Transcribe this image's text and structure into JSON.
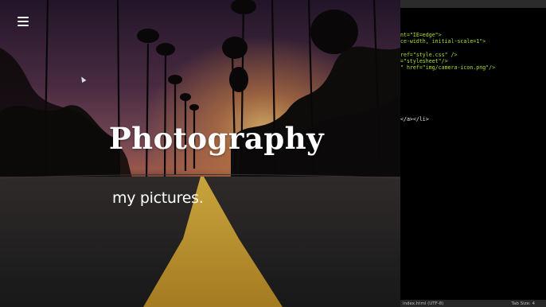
{
  "site": {
    "menu_icon": "hamburger-menu-icon",
    "title": "Photography",
    "subtitle": "my pictures."
  },
  "editor": {
    "code_lines": [
      {
        "parts": [
          {
            "t": "nt=\"IE=edge\">",
            "c": "g"
          }
        ]
      },
      {
        "parts": [
          {
            "t": "ce-width, initial-scale=1\">",
            "c": "g"
          }
        ]
      },
      {
        "parts": [
          {
            "t": "",
            "c": "w"
          }
        ]
      },
      {
        "parts": [
          {
            "t": "ref=\"style.css\" />",
            "c": "g"
          }
        ]
      },
      {
        "parts": [
          {
            "t": "=\"stylesheet\"/>",
            "c": "g"
          }
        ]
      },
      {
        "parts": [
          {
            "t": "\" href=\"img/camera-icon.png\"/>",
            "c": "g"
          }
        ]
      },
      {
        "parts": [
          {
            "t": "",
            "c": "w"
          }
        ]
      },
      {
        "parts": [
          {
            "t": "",
            "c": "w"
          }
        ]
      },
      {
        "parts": [
          {
            "t": "",
            "c": "w"
          }
        ]
      },
      {
        "parts": [
          {
            "t": "",
            "c": "w"
          }
        ]
      },
      {
        "parts": [
          {
            "t": "",
            "c": "w"
          }
        ]
      },
      {
        "parts": [
          {
            "t": "",
            "c": "w"
          }
        ]
      },
      {
        "parts": [
          {
            "t": "",
            "c": "w"
          }
        ]
      },
      {
        "parts": [
          {
            "t": "</a></li>",
            "c": "w"
          }
        ]
      }
    ],
    "status_file": "index.html (UTF-8)",
    "status_tab": "Tab Size: 4"
  },
  "colors": {
    "sky_top": "#2a1a33",
    "sky_mid": "#7a4a5e",
    "sky_glow": "#f2a85a",
    "road": "#2b2b2b",
    "road_line": "#e0b534",
    "editor_bg": "#000000",
    "code_green": "#a6e22e"
  }
}
